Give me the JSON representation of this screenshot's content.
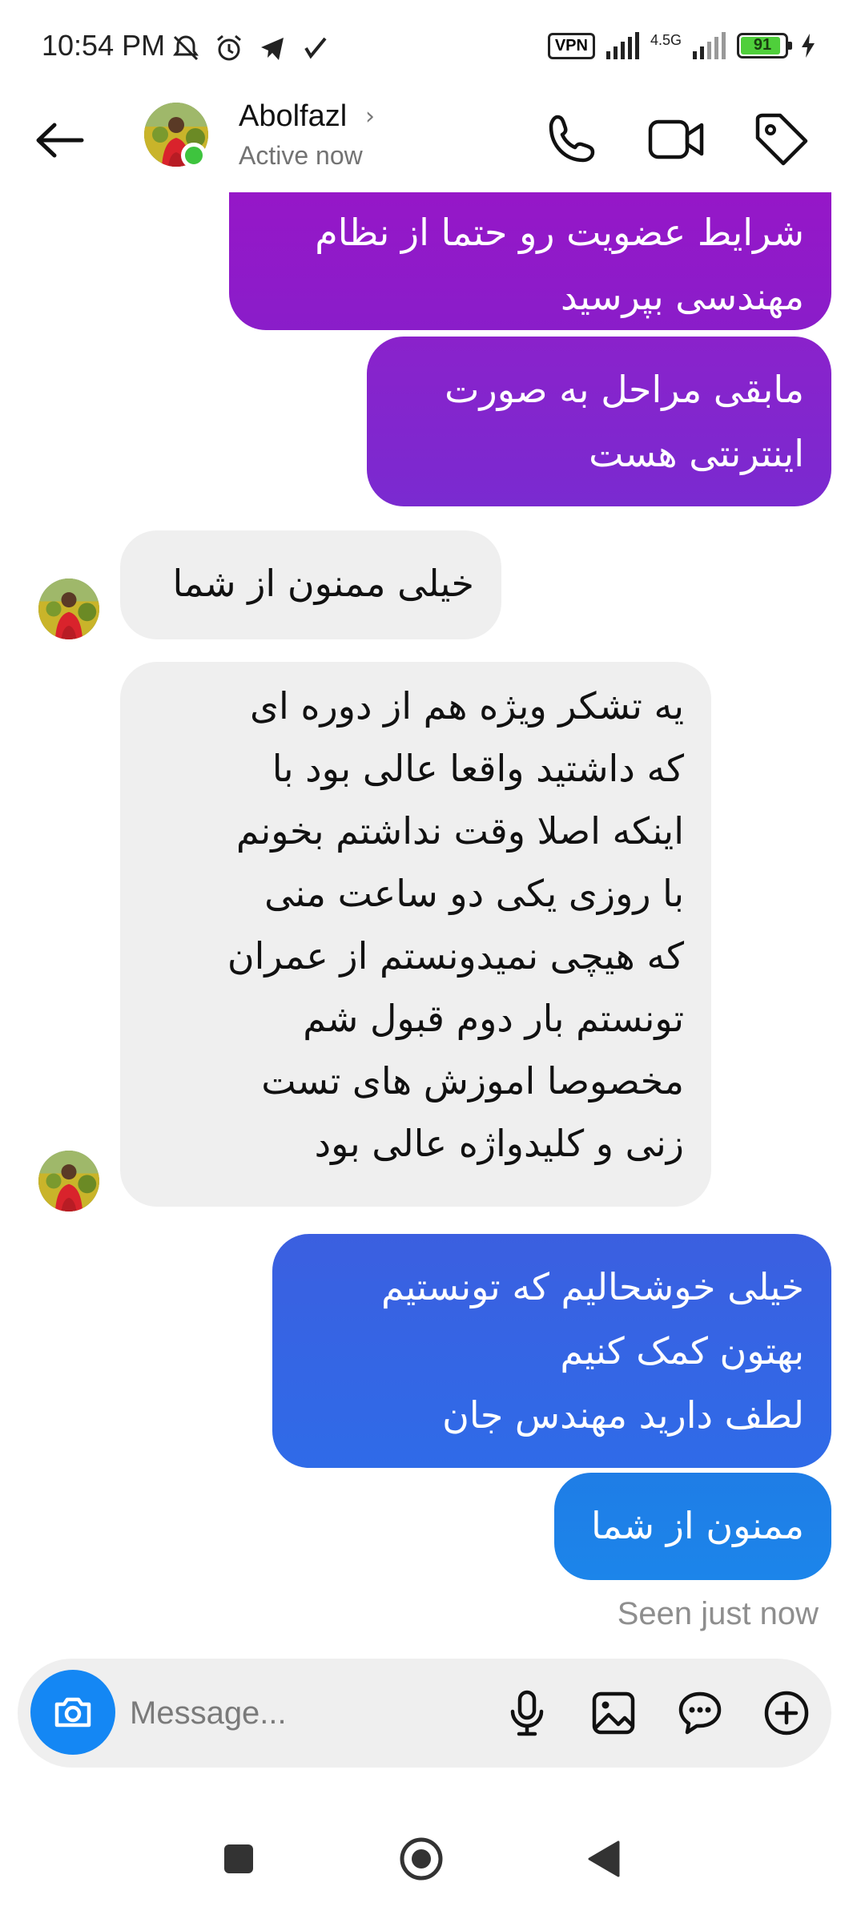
{
  "status_bar": {
    "time": "10:54 PM",
    "vpn": "VPN",
    "network": "4.5G",
    "battery": "91",
    "battery_level": 0.91
  },
  "header": {
    "contact_name": "Abolfazl",
    "contact_status": "Active now"
  },
  "messages": [
    {
      "direction": "outgoing",
      "lines": [
        "شرایط عضویت رو حتما از نظام",
        "مهندسی بپرسید"
      ],
      "color_top": "#9b14c8",
      "color_bottom": "#8a1dc9"
    },
    {
      "direction": "outgoing",
      "lines": [
        "مابقی مراحل به صورت",
        "اینترنتی هست"
      ],
      "color_top": "#8a22cb",
      "color_bottom": "#7a2ad0"
    },
    {
      "direction": "incoming",
      "lines": [
        "خیلی ممنون از شما"
      ]
    },
    {
      "direction": "incoming",
      "lines": [
        "یه تشکر ویژه هم از دوره ای",
        "که داشتید واقعا عالی بود با",
        "اینکه اصلا وقت نداشتم بخونم",
        "با روزی یکی دو ساعت منی",
        "که هیچی نمیدونستم از عمران",
        "تونستم بار دوم قبول شم",
        "مخصوصا اموزش های تست",
        "زنی و کلیدواژه عالی بود"
      ]
    },
    {
      "direction": "outgoing",
      "lines": [
        "خیلی خوشحالیم که تونستیم",
        "بهتون کمک کنیم",
        "لطف دارید مهندس جان"
      ],
      "color_top": "#3b5fe0",
      "color_bottom": "#2f6be8"
    },
    {
      "direction": "outgoing",
      "lines": [
        "ممنون از شما"
      ],
      "color_top": "#1f7de6",
      "color_bottom": "#1c85ea"
    }
  ],
  "seen_label": "Seen just now",
  "composer": {
    "placeholder": "Message..."
  },
  "colors": {
    "online": "#3ec43e",
    "camera_button": "#1487f4",
    "incoming_bubble": "#efefef"
  },
  "icons": {
    "header": [
      "back-arrow-icon",
      "phone-icon",
      "video-camera-icon",
      "tag-icon"
    ],
    "composer": [
      "camera-icon",
      "microphone-icon",
      "image-icon",
      "sticker-icon",
      "plus-circle-icon"
    ],
    "nav": [
      "recent-apps-icon",
      "home-icon",
      "back-triangle-icon"
    ]
  }
}
